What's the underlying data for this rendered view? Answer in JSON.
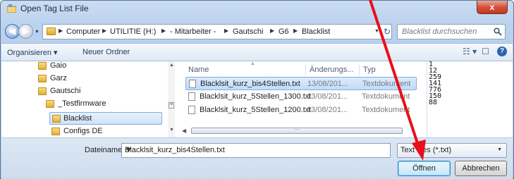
{
  "window": {
    "title": "Open Tag List File",
    "close_label": "x"
  },
  "address": {
    "crumbs": [
      "Computer",
      "UTILITIE (H:)",
      "- Mitarbeiter -",
      "Gautschi",
      "G6",
      "Blacklist"
    ]
  },
  "search": {
    "placeholder": "Blacklist durchsuchen"
  },
  "toolbar": {
    "organize_label": "Organisieren ▾",
    "new_folder_label": "Neuer Ordner"
  },
  "tree": {
    "items": [
      {
        "label": "Gaio"
      },
      {
        "label": "Garz"
      },
      {
        "label": "Gautschi"
      },
      {
        "label": "_Testfirmware"
      },
      {
        "label": "Blacklist",
        "selected": true
      },
      {
        "label": "Configs DE"
      }
    ]
  },
  "file_list": {
    "columns": [
      "Name",
      "Änderungs...",
      "Typ"
    ],
    "rows": [
      {
        "name": "Blacklsit_kurz_bis4Stellen.txt",
        "date": "13/08/201...",
        "type": "Textdokument",
        "selected": true
      },
      {
        "name": "Blacklsit_kurz_5Stellen_1300.txt",
        "date": "13/08/201...",
        "type": "Textdokument"
      },
      {
        "name": "Blacklsit_kurz_5Stellen_1200.txt",
        "date": "13/08/201...",
        "type": "Textdokument"
      }
    ]
  },
  "preview": {
    "lines": [
      "1",
      "12",
      "259",
      "141",
      "776",
      "150",
      "88"
    ]
  },
  "filename": {
    "label": "Dateiname:",
    "value": "Blacklsit_kurz_bis4Stellen.txt"
  },
  "filter": {
    "value": "Text files (*.txt)"
  },
  "buttons": {
    "open_label": "Öffnen",
    "cancel_label": "Abbrechen"
  },
  "colors": {
    "annotation_arrow": "#e8101a",
    "selection": "#cfe3f8"
  }
}
